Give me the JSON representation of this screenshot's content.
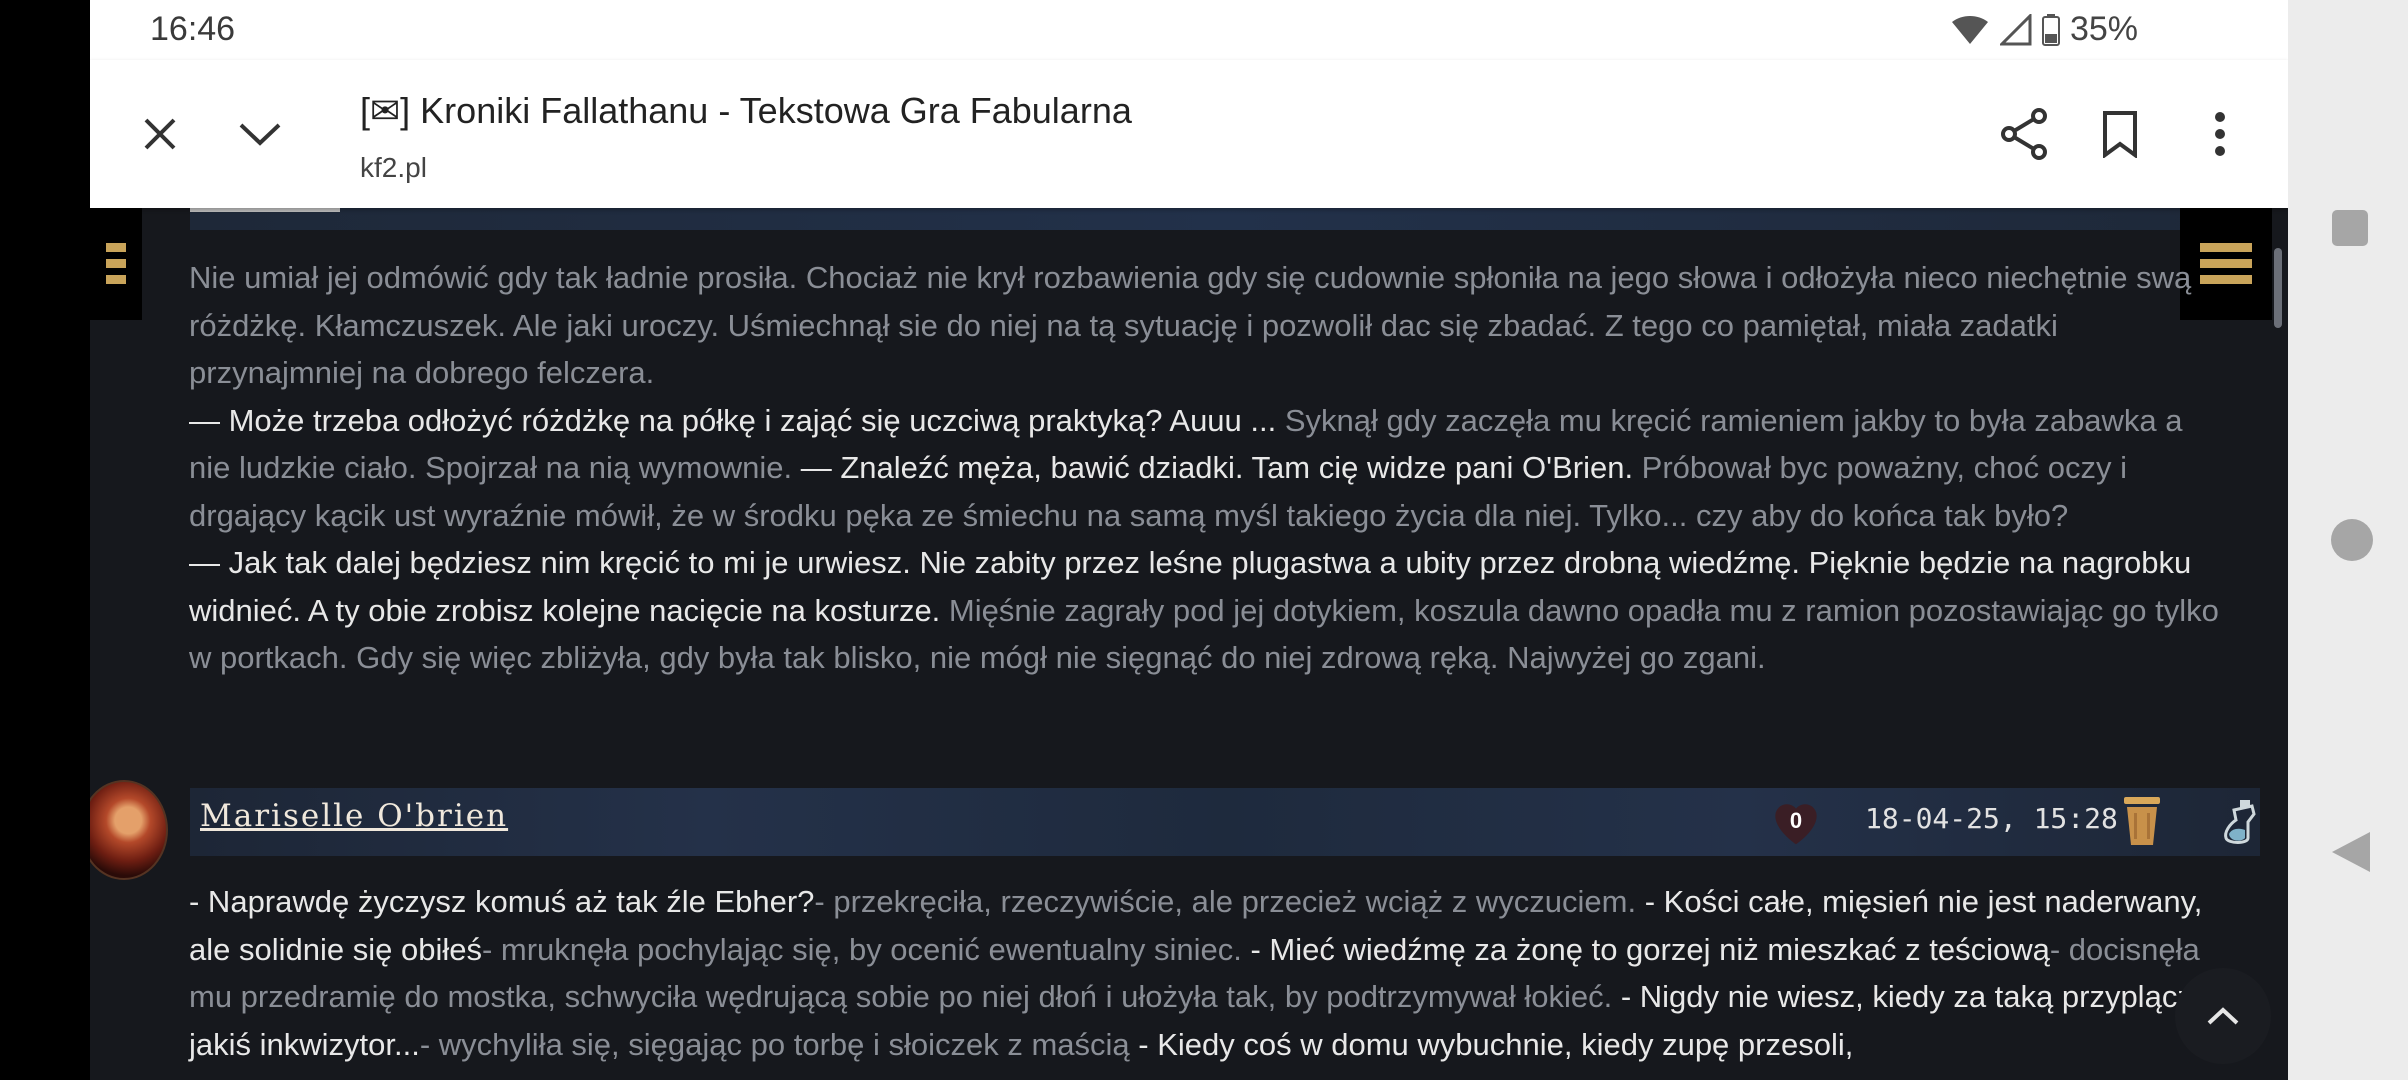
{
  "status": {
    "time": "16:46",
    "battery": "35%"
  },
  "browser": {
    "title": "[✉] Kroniki Fallathanu - Tekstowa Gra Fabularna",
    "url": "kf2.pl",
    "icons": [
      "close-icon",
      "chevron-down-icon",
      "share-icon",
      "bookmark-icon",
      "more-vert-icon"
    ]
  },
  "post1": {
    "segments": [
      {
        "t": "Nie umiał jej odmówić gdy tak ładnie prosiła. Chociaż nie krył rozbawienia gdy się cudownie spłoniła na jego słowa i odłożyła nieco niechętnie swą różdżkę. Kłamczuszek. Ale jaki uroczy. Uśmiechnął sie do niej na tą sytuację i pozwolił dac się zbadać. Z tego co pamiętał, miała zadatki przynajmniej na dobrego felczera.",
        "c": "g"
      },
      {
        "t": "— Może trzeba odłożyć różdżkę na półkę i zająć się uczciwą praktyką? Auuu ...",
        "c": "w"
      },
      {
        "t": " Syknął gdy zaczęła mu kręcić ramieniem jakby to była zabawka a nie ludzkie ciało. Spojrzał na nią wymownie. ",
        "c": "g"
      },
      {
        "t": "— Znaleźć męża, bawić dziadki. Tam cię widze pani O'Brien.",
        "c": "w"
      },
      {
        "t": " Próbował byc poważny, choć oczy i drgający kącik ust wyraźnie mówił, że w środku pęka ze śmiechu na samą myśl takiego życia dla niej. Tylko... czy aby do końca tak było?",
        "c": "g"
      },
      {
        "t": "— Jak tak dalej będziesz nim kręcić to mi je urwiesz. Nie zabity przez leśne plugastwa a ubity przez drobną wiedźmę. Pięknie będzie na nagrobku widnieć. A ty obie zrobisz kolejne nacięcie na kosturze.",
        "c": "w"
      },
      {
        "t": " Mięśnie zagrały pod jej dotykiem, koszula dawno opadła mu z ramion pozostawiając go tylko w portkach. Gdy się więc zbliżyła, gdy była tak blisko, nie mógł nie sięgnąć do niej zdrową ręką. Najwyżej go zgani.",
        "c": "g"
      }
    ]
  },
  "post2": {
    "author": "Mariselle O'brien",
    "likes": "0",
    "date": "18-04-25, 15:28",
    "segments": [
      {
        "t": "- Naprawdę życzysz komuś aż tak źle Ebher?",
        "c": "w"
      },
      {
        "t": "- przekręciła, rzeczywiście, ale przecież wciąż z wyczuciem. ",
        "c": "g"
      },
      {
        "t": "- Kości całe, mięsień nie jest naderwany, ale solidnie się obiłeś",
        "c": "w"
      },
      {
        "t": "- mruknęła pochylając się, by ocenić ewentualny siniec. ",
        "c": "g"
      },
      {
        "t": "- Mieć wiedźmę za żonę to gorzej niż mieszkać z teściową",
        "c": "w"
      },
      {
        "t": "- docisnęła mu przedramię do mostka, schwyciła wędrującą sobie po niej dłoń i ułożyła tak, by podtrzymywał łokieć. ",
        "c": "g"
      },
      {
        "t": "- Nigdy nie wiesz, kiedy za taką przyplącze jakiś inkwizytor...",
        "c": "w"
      },
      {
        "t": "- wychyliła się, sięgając po torbę i słoiczek z maścią ",
        "c": "g"
      },
      {
        "t": "- Kiedy coś w domu wybuchnie, kiedy zupę przesoli,",
        "c": "w"
      }
    ]
  }
}
